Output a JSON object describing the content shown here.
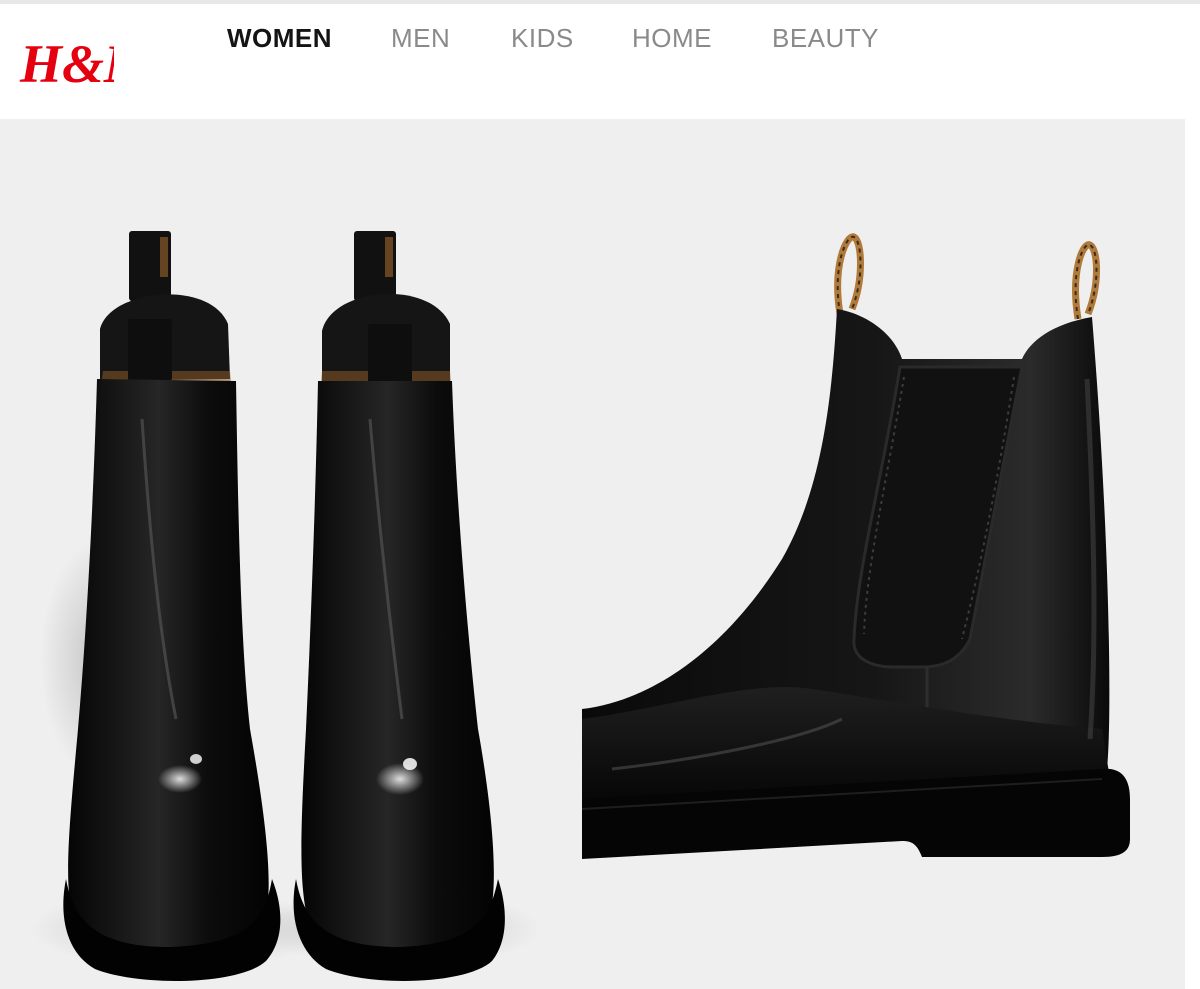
{
  "header": {
    "logo_text": "H&M",
    "nav": [
      {
        "label": "WOMEN",
        "active": true
      },
      {
        "label": "MEN",
        "active": false
      },
      {
        "label": "KIDS",
        "active": false
      },
      {
        "label": "HOME",
        "active": false
      },
      {
        "label": "BEAUTY",
        "active": false
      }
    ]
  },
  "colors": {
    "brand_red": "#e50010",
    "nav_active": "#141414",
    "nav_inactive": "#8a8a8a",
    "image_background": "#efefef",
    "boot": "#0b0b0b",
    "pull_tab_trim": "#b07a3a"
  },
  "product_images": [
    {
      "id": "boots-pair-front-view"
    },
    {
      "id": "boot-side-closeup-view"
    }
  ]
}
